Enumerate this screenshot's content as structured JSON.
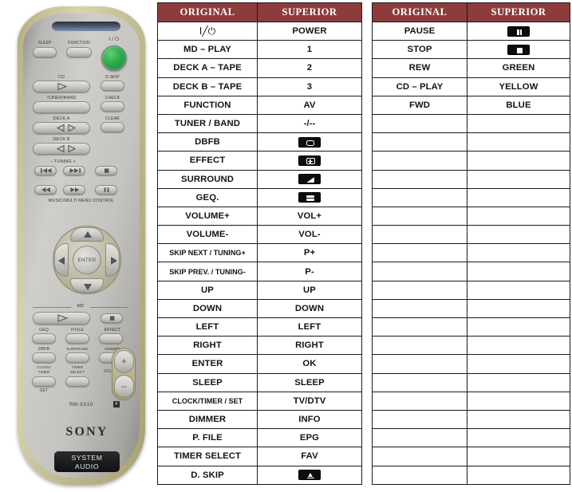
{
  "remote": {
    "brand": "SONY",
    "model": "RM-SX10",
    "badge": "SYSTEM\nAUDIO",
    "badge_line1": "SYSTEM",
    "badge_line2": "AUDIO",
    "model_mark": "F",
    "buttons": [
      {
        "label": "SLEEP"
      },
      {
        "label": "FUNCTION"
      },
      {
        "label": "I / ⏻"
      },
      {
        "label": "CD"
      },
      {
        "label": "D.SKIP"
      },
      {
        "label": "TUNER/BAND"
      },
      {
        "label": "CHECK"
      },
      {
        "label": "DECK A"
      },
      {
        "label": "CLEAR"
      },
      {
        "label": "DECK B"
      },
      {
        "label": "–  TUNING  +"
      },
      {
        "label": "MUSIC/MULTI MENU CONTROL"
      },
      {
        "label": "ENTER"
      },
      {
        "label": "MD"
      },
      {
        "label": "GEQ"
      },
      {
        "label": "P.FILE"
      },
      {
        "label": "EFFECT"
      },
      {
        "label": "DBFB"
      },
      {
        "label": "SURROUND"
      },
      {
        "label": "DIMMER"
      },
      {
        "label": "CLOCK/\nTIMER"
      },
      {
        "label": "TIMER\nSELECT"
      },
      {
        "label": "VOLUME"
      },
      {
        "label": "SET"
      }
    ]
  },
  "table_left": {
    "headers": [
      "ORIGINAL",
      "SUPERIOR"
    ],
    "rows": [
      {
        "original": "I╱⏻",
        "superior": "POWER",
        "orig_sym": true
      },
      {
        "original": "MD – PLAY",
        "superior": "1"
      },
      {
        "original": "DECK A – TAPE",
        "superior": "2"
      },
      {
        "original": "DECK B – TAPE",
        "superior": "3"
      },
      {
        "original": "FUNCTION",
        "superior": "AV"
      },
      {
        "original": "TUNER / BAND",
        "superior": "-/--"
      },
      {
        "original": "DBFB",
        "superior": "",
        "icon": "screen-rect"
      },
      {
        "original": "EFFECT",
        "superior": "",
        "icon": "screen-plus"
      },
      {
        "original": "SURROUND",
        "superior": "",
        "icon": "screen-diag"
      },
      {
        "original": "GEQ.",
        "superior": "",
        "icon": "screen-bars"
      },
      {
        "original": "VOLUME+",
        "superior": "VOL+"
      },
      {
        "original": "VOLUME-",
        "superior": "VOL-"
      },
      {
        "original": "SKIP NEXT / TUNING+",
        "superior": "P+",
        "small": true
      },
      {
        "original": "SKIP PREV. / TUNING-",
        "superior": "P-",
        "small": true
      },
      {
        "original": "UP",
        "superior": "UP"
      },
      {
        "original": "DOWN",
        "superior": "DOWN"
      },
      {
        "original": "LEFT",
        "superior": "LEFT"
      },
      {
        "original": "RIGHT",
        "superior": "RIGHT"
      },
      {
        "original": "ENTER",
        "superior": "OK"
      },
      {
        "original": "SLEEP",
        "superior": "SLEEP"
      },
      {
        "original": "CLOCK/TIMER / SET",
        "superior": "TV/DTV",
        "small": true
      },
      {
        "original": "DIMMER",
        "superior": "INFO"
      },
      {
        "original": "P. FILE",
        "superior": "EPG"
      },
      {
        "original": "TIMER SELECT",
        "superior": "FAV"
      },
      {
        "original": "D. SKIP",
        "superior": "",
        "icon": "eject-tri"
      }
    ]
  },
  "table_right": {
    "headers": [
      "ORIGINAL",
      "SUPERIOR"
    ],
    "rows": [
      {
        "original": "PAUSE",
        "superior": "",
        "icon": "pause"
      },
      {
        "original": "STOP",
        "superior": "",
        "icon": "stop"
      },
      {
        "original": "REW",
        "superior": "GREEN"
      },
      {
        "original": "CD – PLAY",
        "superior": "YELLOW"
      },
      {
        "original": "FWD",
        "superior": "BLUE"
      },
      {
        "original": "",
        "superior": ""
      },
      {
        "original": "",
        "superior": ""
      },
      {
        "original": "",
        "superior": ""
      },
      {
        "original": "",
        "superior": ""
      },
      {
        "original": "",
        "superior": ""
      },
      {
        "original": "",
        "superior": ""
      },
      {
        "original": "",
        "superior": ""
      },
      {
        "original": "",
        "superior": ""
      },
      {
        "original": "",
        "superior": ""
      },
      {
        "original": "",
        "superior": ""
      },
      {
        "original": "",
        "superior": ""
      },
      {
        "original": "",
        "superior": ""
      },
      {
        "original": "",
        "superior": ""
      },
      {
        "original": "",
        "superior": ""
      },
      {
        "original": "",
        "superior": ""
      },
      {
        "original": "",
        "superior": ""
      },
      {
        "original": "",
        "superior": ""
      },
      {
        "original": "",
        "superior": ""
      },
      {
        "original": "",
        "superior": ""
      },
      {
        "original": "",
        "superior": ""
      }
    ]
  },
  "colors": {
    "header_bg": "#8e3b3b",
    "header_text": "#ffffff",
    "border": "#1a1a1a",
    "page_bg": "#ffffff",
    "power_button": "#2faa4c"
  }
}
